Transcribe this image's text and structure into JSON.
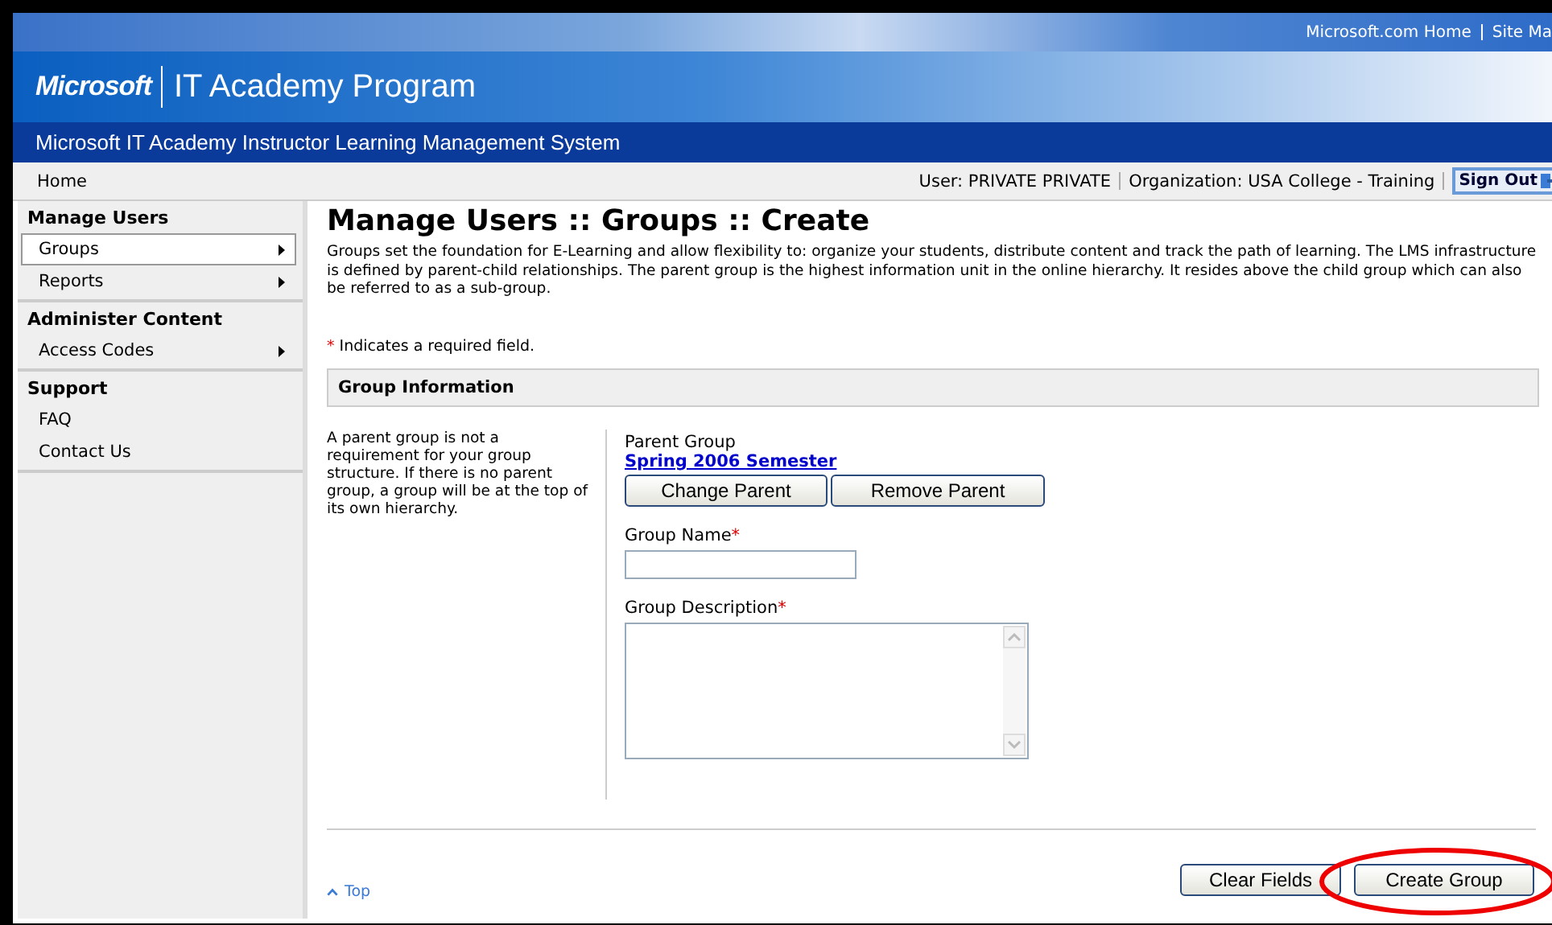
{
  "top_links": [
    "Microsoft.com Home",
    "Site Ma"
  ],
  "brand": {
    "logo": "Microsoft",
    "program": "IT Academy Program"
  },
  "system_title": "Microsoft IT Academy Instructor Learning Management System",
  "nav_bar": {
    "home": "Home",
    "user": "User: PRIVATE PRIVATE",
    "organization": "Organization: USA College - Training",
    "sign_out": "Sign Out"
  },
  "sidebar": [
    {
      "heading": "Manage Users",
      "items": [
        {
          "label": "Groups",
          "has_submenu": true,
          "selected": true
        },
        {
          "label": "Reports",
          "has_submenu": true,
          "selected": false
        }
      ]
    },
    {
      "heading": "Administer Content",
      "items": [
        {
          "label": "Access Codes",
          "has_submenu": true,
          "selected": false
        }
      ]
    },
    {
      "heading": "Support",
      "items": [
        {
          "label": "FAQ",
          "has_submenu": false,
          "selected": false
        },
        {
          "label": "Contact Us",
          "has_submenu": false,
          "selected": false
        }
      ]
    }
  ],
  "page_title": "Manage Users :: Groups :: Create",
  "intro": "Groups set the foundation for E-Learning and allow flexibility to: organize your students, distribute content and track the path of learning. The LMS infrastructure is defined by parent-child relationships. The parent group is the highest information unit in the online hierarchy. It resides above the child group which can also be referred to as a sub-group.",
  "required_note": {
    "mark": "*",
    "text": "Indicates a required field."
  },
  "section_title": "Group Information",
  "help_text": "A parent group is not a requirement for your group structure. If there is no parent group, a group will be at the top of its own hierarchy.",
  "parent_group": {
    "label": "Parent Group",
    "value": "Spring 2006 Semester",
    "buttons": [
      "Change Parent",
      "Remove Parent"
    ]
  },
  "fields": [
    {
      "kind": "text",
      "label": "Group Name",
      "required": true
    },
    {
      "kind": "textarea",
      "label": "Group Description",
      "required": true
    }
  ],
  "top_link": "Top",
  "actions": [
    {
      "label": "Clear Fields",
      "circled": false
    },
    {
      "label": "Create Group",
      "circled": true
    }
  ]
}
